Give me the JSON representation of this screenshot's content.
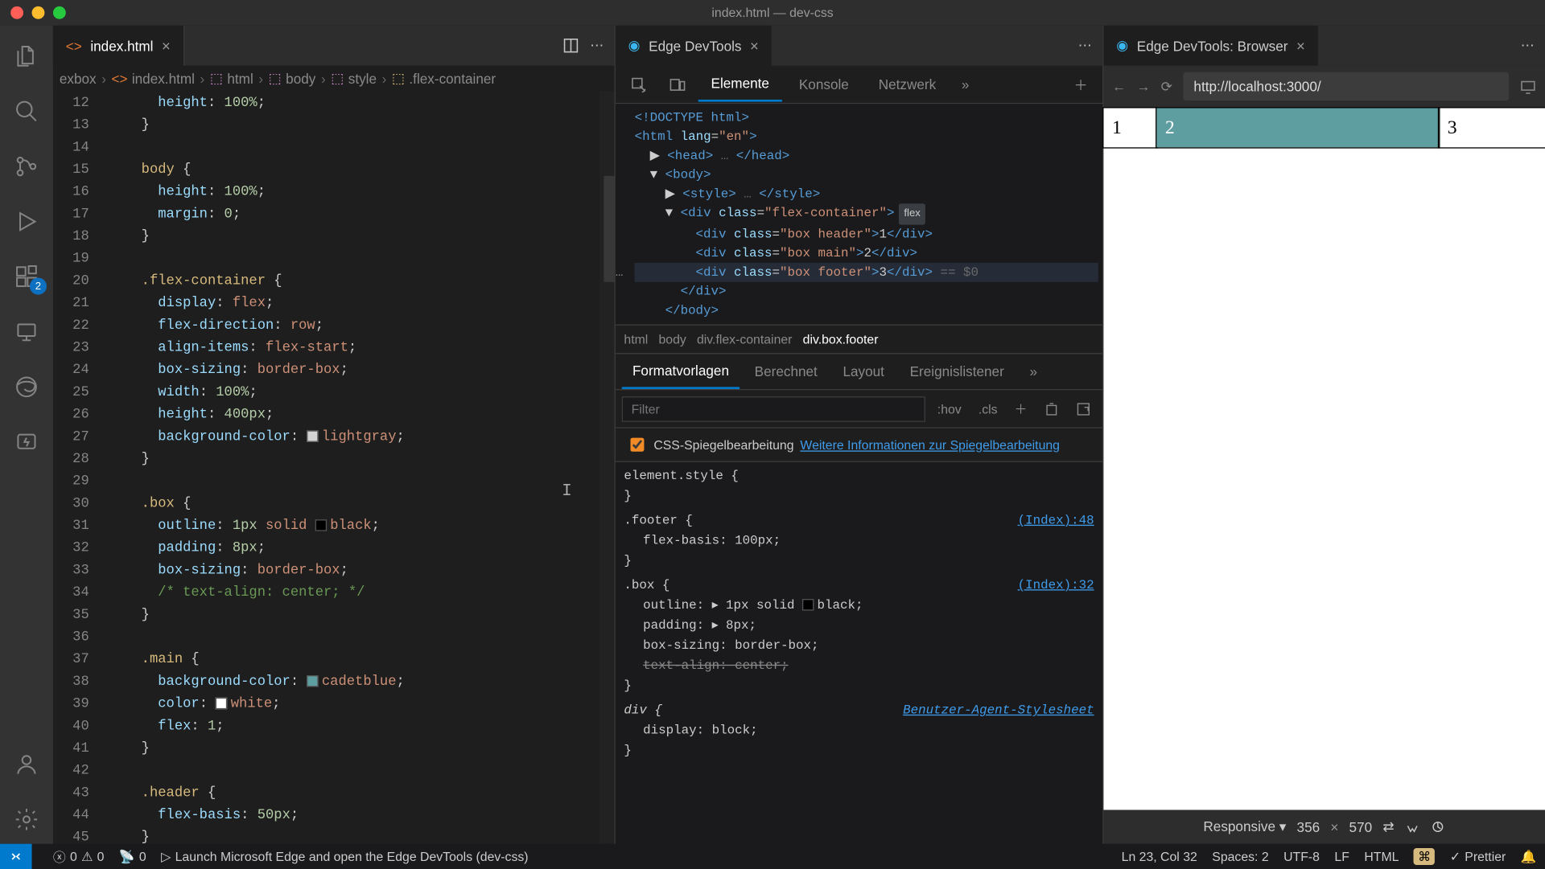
{
  "window": {
    "title": "index.html — dev-css"
  },
  "activity": {
    "extensions_badge": "2"
  },
  "editor": {
    "tab": {
      "name": "index.html"
    },
    "breadcrumb": [
      "exbox",
      "index.html",
      "html",
      "body",
      "style",
      ".flex-container"
    ],
    "lines": [
      {
        "n": 12,
        "code": "      <span class='prop'>height</span>: <span class='num'>100%</span>;"
      },
      {
        "n": 13,
        "code": "    }"
      },
      {
        "n": 14,
        "code": ""
      },
      {
        "n": 15,
        "code": "    <span class='sel'>body</span> {"
      },
      {
        "n": 16,
        "code": "      <span class='prop'>height</span>: <span class='num'>100%</span>;"
      },
      {
        "n": 17,
        "code": "      <span class='prop'>margin</span>: <span class='num'>0</span>;"
      },
      {
        "n": 18,
        "code": "    }"
      },
      {
        "n": 19,
        "code": ""
      },
      {
        "n": 20,
        "code": "    <span class='sel'>.flex-container</span> {"
      },
      {
        "n": 21,
        "code": "      <span class='prop'>display</span>: <span class='val'>flex</span>;"
      },
      {
        "n": 22,
        "code": "      <span class='prop'>flex-direction</span>: <span class='val'>row</span>;"
      },
      {
        "n": 23,
        "code": "      <span class='prop'>align-items</span>: <span class='val'>flex-start</span>;"
      },
      {
        "n": 24,
        "code": "      <span class='prop'>box-sizing</span>: <span class='val'>border-box</span>;"
      },
      {
        "n": 25,
        "code": "      <span class='prop'>width</span>: <span class='num'>100%</span>;"
      },
      {
        "n": 26,
        "code": "      <span class='prop'>height</span>: <span class='num'>400px</span>;"
      },
      {
        "n": 27,
        "code": "      <span class='prop'>background-color</span>: <span class='swatch' style='background:lightgray'></span><span class='val'>lightgray</span>;"
      },
      {
        "n": 28,
        "code": "    }"
      },
      {
        "n": 29,
        "code": ""
      },
      {
        "n": 30,
        "code": "    <span class='sel'>.box</span> {"
      },
      {
        "n": 31,
        "code": "      <span class='prop'>outline</span>: <span class='num'>1px</span> <span class='val'>solid</span> <span class='swatch' style='background:black'></span><span class='val'>black</span>;"
      },
      {
        "n": 32,
        "code": "      <span class='prop'>padding</span>: <span class='num'>8px</span>;"
      },
      {
        "n": 33,
        "code": "      <span class='prop'>box-sizing</span>: <span class='val'>border-box</span>;"
      },
      {
        "n": 34,
        "code": "      <span class='cmt'>/* text-align: center; */</span>"
      },
      {
        "n": 35,
        "code": "    }"
      },
      {
        "n": 36,
        "code": ""
      },
      {
        "n": 37,
        "code": "    <span class='sel'>.main</span> {"
      },
      {
        "n": 38,
        "code": "      <span class='prop'>background-color</span>: <span class='swatch' style='background:cadetblue'></span><span class='val'>cadetblue</span>;"
      },
      {
        "n": 39,
        "code": "      <span class='prop'>color</span>: <span class='swatch' style='background:white'></span><span class='val'>white</span>;"
      },
      {
        "n": 40,
        "code": "      <span class='prop'>flex</span>: <span class='num'>1</span>;"
      },
      {
        "n": 41,
        "code": "    }"
      },
      {
        "n": 42,
        "code": ""
      },
      {
        "n": 43,
        "code": "    <span class='sel'>.header</span> {"
      },
      {
        "n": 44,
        "code": "      <span class='prop'>flex-basis</span>: <span class='num'>50px</span>;"
      },
      {
        "n": 45,
        "code": "    }"
      }
    ]
  },
  "devtools": {
    "tab": {
      "name": "Edge DevTools"
    },
    "tabs": [
      "Elemente",
      "Konsole",
      "Netzwerk"
    ],
    "elements": [
      "<span class='tag'>&lt;!DOCTYPE html&gt;</span>",
      "<span class='tag'>&lt;html</span> <span class='attr'>lang</span>=<span class='str'>\"en\"</span><span class='tag'>&gt;</span>",
      "  ▶ <span class='tag'>&lt;head&gt;</span> <span class='sel-dim'>…</span> <span class='tag'>&lt;/head&gt;</span>",
      "  ▼ <span class='tag'>&lt;body&gt;</span>",
      "    ▶ <span class='tag'>&lt;style&gt;</span> <span class='sel-dim'>…</span> <span class='tag'>&lt;/style&gt;</span>",
      "    ▼ <span class='tag'>&lt;div</span> <span class='attr'>class</span>=<span class='str'>\"flex-container\"</span><span class='tag'>&gt;</span><span class='flex-badge'>flex</span>",
      "        <span class='tag'>&lt;div</span> <span class='attr'>class</span>=<span class='str'>\"box header\"</span><span class='tag'>&gt;</span>1<span class='tag'>&lt;/div&gt;</span>",
      "        <span class='tag'>&lt;div</span> <span class='attr'>class</span>=<span class='str'>\"box main\"</span><span class='tag'>&gt;</span>2<span class='tag'>&lt;/div&gt;</span>",
      "<span class='dots-overlay'>…</span>        <span class='tag'>&lt;div</span> <span class='attr'>class</span>=<span class='str'>\"box footer\"</span><span class='tag'>&gt;</span>3<span class='tag'>&lt;/div&gt;</span> <span class='sel-dim'>== $0</span>",
      "      <span class='tag'>&lt;/div&gt;</span>",
      "    <span class='tag'>&lt;/body&gt;</span>"
    ],
    "elements_highlight": 8,
    "dom_breadcrumb": [
      "html",
      "body",
      "div.flex-container",
      "div.box.footer"
    ],
    "styles_tabs": [
      "Formatvorlagen",
      "Berechnet",
      "Layout",
      "Ereignislistener"
    ],
    "filter_placeholder": "Filter",
    "hov": ":hov",
    "cls": ".cls",
    "mirror_label": "CSS-Spiegelbearbeitung",
    "mirror_link": "Weitere Informationen zur Spiegelbearbeitung",
    "rules": [
      {
        "selector": "element.style",
        "props": []
      },
      {
        "selector": ".footer",
        "source": "(Index):48",
        "props": [
          {
            "name": "flex-basis",
            "value": "100px"
          }
        ]
      },
      {
        "selector": ".box",
        "source": "(Index):32",
        "props": [
          {
            "name": "outline",
            "value": "▸ 1px solid ",
            "swatch": "black",
            "tail": "black"
          },
          {
            "name": "padding",
            "value": "▸ 8px"
          },
          {
            "name": "box-sizing",
            "value": "border-box"
          },
          {
            "name": "text-align",
            "value": "center",
            "strike": true
          }
        ]
      },
      {
        "selector": "div",
        "source": "Benutzer-Agent-Stylesheet",
        "italic": true,
        "props": [
          {
            "name": "display",
            "value": "block"
          }
        ]
      }
    ]
  },
  "browser": {
    "tab": {
      "name": "Edge DevTools: Browser"
    },
    "url": "http://localhost:3000/",
    "cells": [
      "1",
      "2",
      "3"
    ],
    "device": "Responsive",
    "width": "356",
    "height": "570"
  },
  "status": {
    "errors": "0",
    "warnings": "0",
    "ports": "0",
    "launch": "Launch Microsoft Edge and open the Edge DevTools (dev-css)",
    "cursor": "Ln 23, Col 32",
    "spaces": "Spaces: 2",
    "encoding": "UTF-8",
    "eol": "LF",
    "lang": "HTML",
    "prettier": "Prettier"
  }
}
